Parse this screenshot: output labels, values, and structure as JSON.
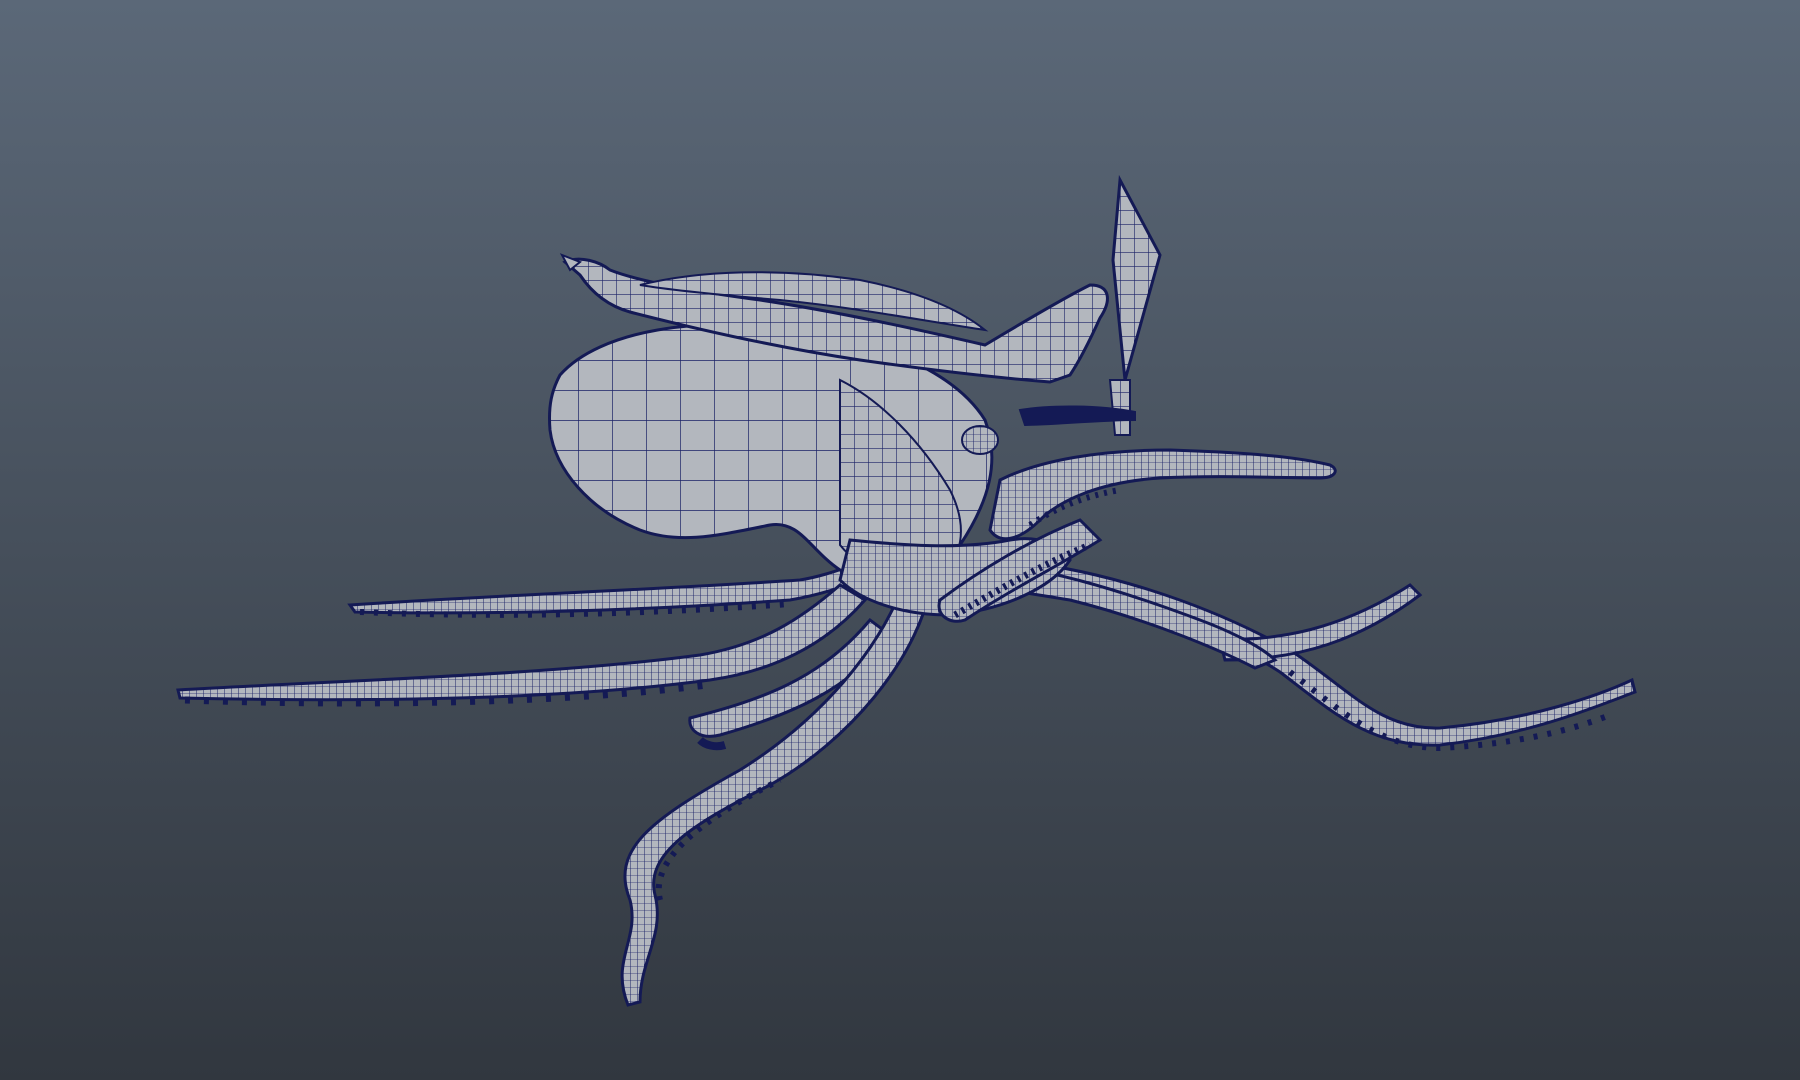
{
  "viewport": {
    "background_top": "#5b6878",
    "background_bottom": "#31373f",
    "mesh_fill": "#b3b7be",
    "mesh_wire": "#1a2166",
    "mesh_outline": "#141a55",
    "sucker_color": "#141a55"
  },
  "scene": {
    "object": "octopus-wireframe-mesh",
    "shading": "wireframe-on-shaded",
    "parts": [
      "mantle",
      "pirate-hat",
      "knife",
      "tentacles"
    ]
  }
}
